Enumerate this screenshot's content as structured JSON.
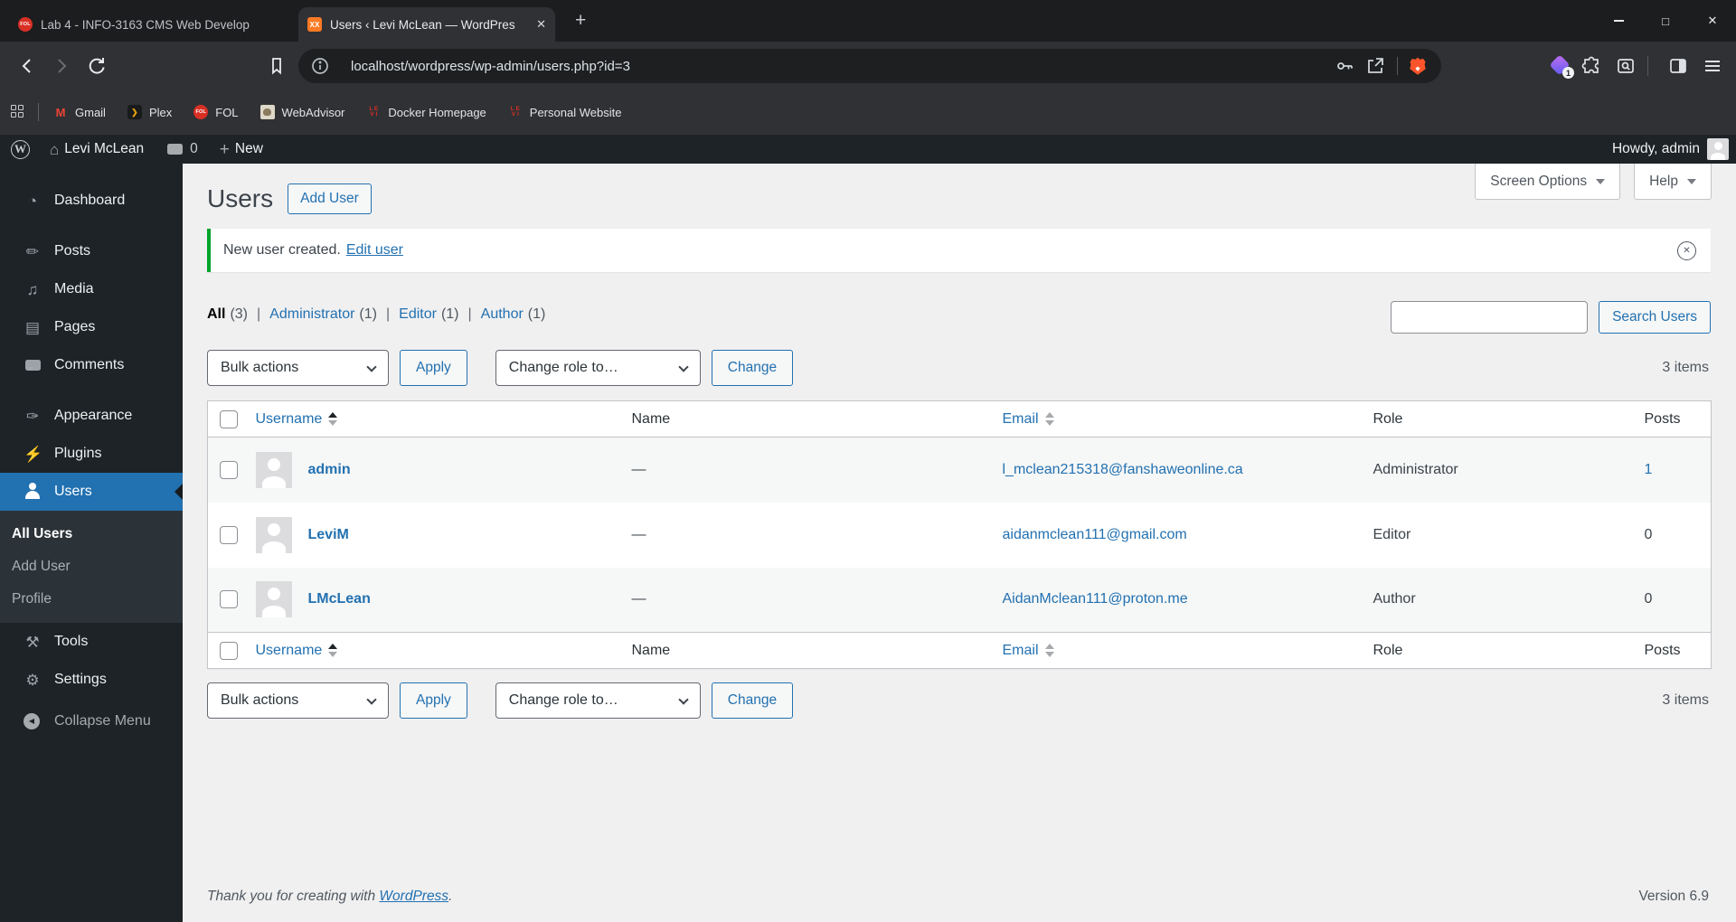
{
  "colors": {
    "accent": "#2271b1",
    "notice_green": "#00a32a",
    "brave_orange": "#fb542b",
    "admin_dark": "#1d2327"
  },
  "browser": {
    "tab1": {
      "title": "Lab 4 - INFO-3163 CMS Web Develop",
      "favicon_text": "FOL"
    },
    "tab2": {
      "title": "Users ‹ Levi McLean — WordPres",
      "favicon_text": "XX"
    },
    "url": "localhost/wordpress/wp-admin/users.php?id=3",
    "extension_badge": "1",
    "bookmarks": [
      {
        "label": "Gmail"
      },
      {
        "label": "Plex"
      },
      {
        "label": "FOL"
      },
      {
        "label": "WebAdvisor"
      },
      {
        "label": "Docker Homepage"
      },
      {
        "label": "Personal Website"
      }
    ]
  },
  "adminbar": {
    "wp": "W",
    "site": "Levi McLean",
    "comment_count": "0",
    "new_label": "New",
    "howdy": "Howdy, admin"
  },
  "sidebar": {
    "items": [
      {
        "label": "Dashboard",
        "glyph": "◔"
      },
      {
        "label": "Posts",
        "glyph": "✏"
      },
      {
        "label": "Media",
        "glyph": "♫"
      },
      {
        "label": "Pages",
        "glyph": "▤"
      },
      {
        "label": "Comments",
        "glyph": ""
      },
      {
        "label": "Appearance",
        "glyph": "✑"
      },
      {
        "label": "Plugins",
        "glyph": "⚡"
      },
      {
        "label": "Users",
        "glyph": ""
      },
      {
        "label": "Tools",
        "glyph": "⚒"
      },
      {
        "label": "Settings",
        "glyph": "⚙"
      },
      {
        "label": "Collapse Menu",
        "glyph": "◀"
      }
    ],
    "users_submenu": [
      {
        "label": "All Users"
      },
      {
        "label": "Add User"
      },
      {
        "label": "Profile"
      }
    ]
  },
  "page": {
    "title": "Users",
    "add_user_button": "Add User",
    "screen_options": "Screen Options",
    "help": "Help",
    "notice": {
      "text": "New user created.",
      "link": "Edit user"
    },
    "filters": [
      {
        "label": "All",
        "count": "(3)"
      },
      {
        "label": "Administrator",
        "count": "(1)"
      },
      {
        "label": "Editor",
        "count": "(1)"
      },
      {
        "label": "Author",
        "count": "(1)"
      }
    ],
    "search": {
      "value": "",
      "button": "Search Users"
    },
    "bulk_actions_label": "Bulk actions",
    "apply_button": "Apply",
    "change_role_label": "Change role to…",
    "change_button": "Change",
    "items_count": "3 items",
    "table": {
      "headers": {
        "username": "Username",
        "name": "Name",
        "email": "Email",
        "role": "Role",
        "posts": "Posts"
      },
      "rows": [
        {
          "username": "admin",
          "name": "—",
          "email": "l_mclean215318@fanshaweonline.ca",
          "role": "Administrator",
          "posts": "1"
        },
        {
          "username": "LeviM",
          "name": "—",
          "email": "aidanmclean111@gmail.com",
          "role": "Editor",
          "posts": "0"
        },
        {
          "username": "LMcLean",
          "name": "—",
          "email": "AidanMclean111@proton.me",
          "role": "Author",
          "posts": "0"
        }
      ]
    },
    "footer": {
      "thanks": "Thank you for creating with",
      "wordpress_link": "WordPress",
      "period": ".",
      "version": "Version 6.9"
    }
  }
}
